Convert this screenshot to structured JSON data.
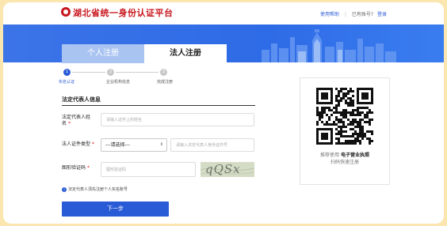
{
  "header": {
    "site_title": "湖北省统一身份认证平台",
    "help_link": "使用帮助",
    "separator": "|",
    "has_account": "已有账号?",
    "login_link": "登录"
  },
  "tabs": [
    {
      "label": "个人注册",
      "active": false
    },
    {
      "label": "法人注册",
      "active": true
    }
  ],
  "steps": [
    {
      "number": "1",
      "label": "实名认证",
      "active": true
    },
    {
      "number": "2",
      "label": "企业机构信息",
      "active": false
    },
    {
      "number": "3",
      "label": "完成注册",
      "active": false
    }
  ],
  "form": {
    "section_title": "法定代表人信息",
    "name": {
      "label": "法定代表人姓名",
      "required_mark": "*",
      "placeholder": "请输入证件上的姓名"
    },
    "id_type": {
      "label": "法人证件类型",
      "required_mark": "*",
      "selected": "---请选择---",
      "id_placeholder": "请输入法定代表人身份证件号"
    },
    "captcha": {
      "label": "图形验证码",
      "required_mark": "*",
      "placeholder": "图形验证码",
      "image_text": "qQSx"
    },
    "hint_icon": "info-icon",
    "hint": "法定代表人须先注册个人实名账号",
    "next_button": "下一步"
  },
  "qr_panel": {
    "line1_prefix": "推荐使用",
    "line1_bold": "电子营业执照",
    "line2": "扫码快速注册"
  },
  "colors": {
    "brand_red": "#c8161e",
    "primary_blue": "#2a5bd7",
    "banner_blue": "#2e6be6",
    "frame_bg": "#fbe6b0"
  }
}
